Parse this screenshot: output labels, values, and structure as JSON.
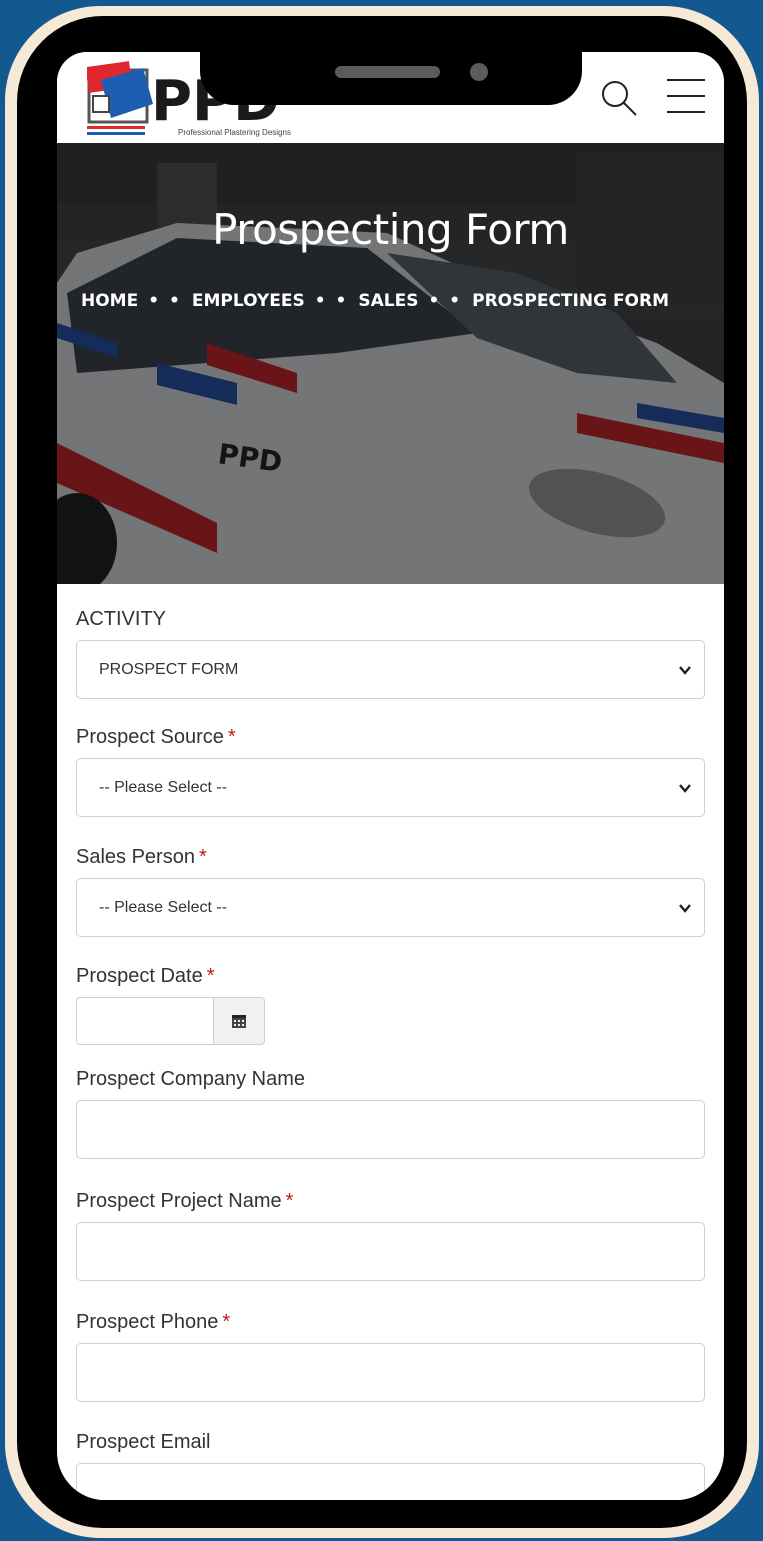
{
  "header": {
    "logo_text": "PPD",
    "logo_tagline": "Professional Plastering Designs"
  },
  "hero": {
    "title": "Prospecting Form",
    "breadcrumb": [
      {
        "label": "HOME"
      },
      {
        "label": "EMPLOYEES"
      },
      {
        "label": "SALES"
      },
      {
        "label": "PROSPECTING FORM"
      }
    ],
    "separator": "• •"
  },
  "form": {
    "required_mark": "*",
    "activity": {
      "label": "ACTIVITY",
      "value": "PROSPECT FORM"
    },
    "prospect_source": {
      "label": "Prospect Source",
      "value": "-- Please Select --"
    },
    "sales_person": {
      "label": "Sales Person",
      "value": "-- Please Select --"
    },
    "prospect_date": {
      "label": "Prospect Date",
      "value": ""
    },
    "company_name": {
      "label": "Prospect Company Name",
      "value": ""
    },
    "project_name": {
      "label": "Prospect Project Name",
      "value": ""
    },
    "phone": {
      "label": "Prospect Phone",
      "value": ""
    },
    "email": {
      "label": "Prospect Email",
      "value": ""
    }
  },
  "colors": {
    "background": "#13598f",
    "frame": "#f7e9d7",
    "brand_blue": "#1e5eb0",
    "brand_red": "#e0262e",
    "required": "#c0161b"
  },
  "icons": {
    "search": "search-icon",
    "menu": "hamburger-menu-icon",
    "calendar": "calendar-icon",
    "dropdown": "chevron-down-icon"
  }
}
